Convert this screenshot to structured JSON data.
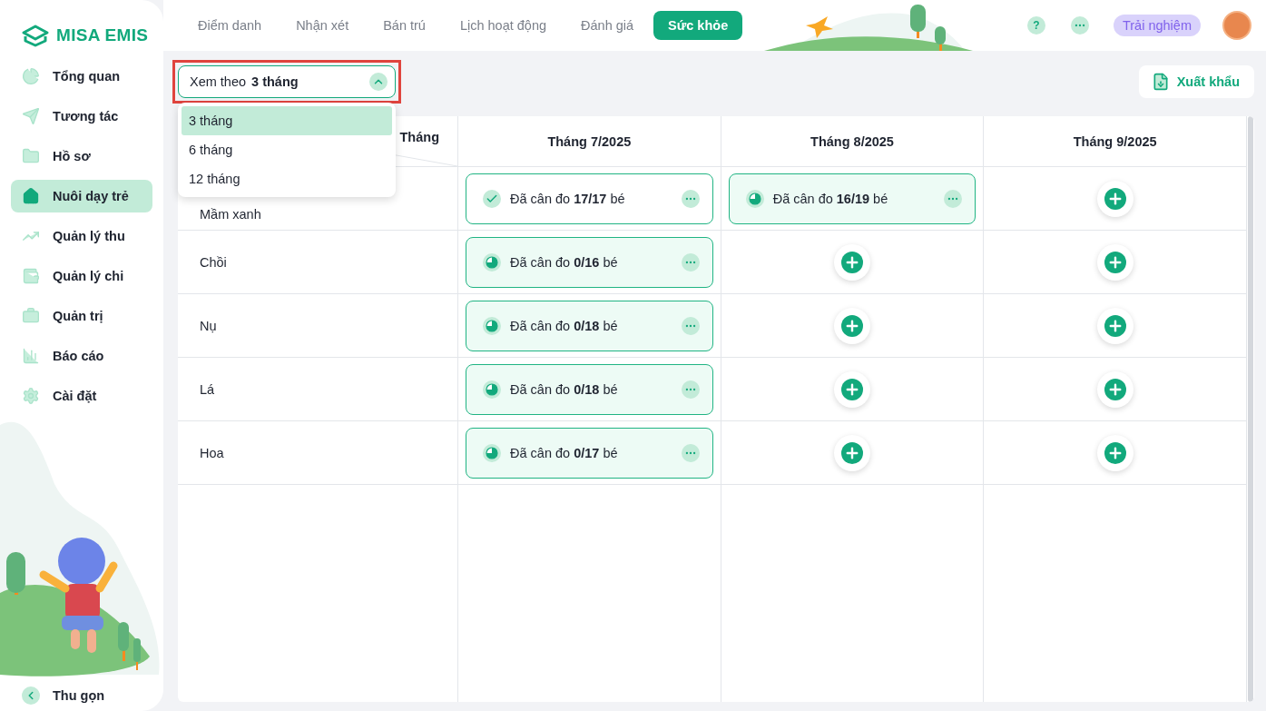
{
  "sidebar": {
    "logo": "MISA EMIS",
    "items": [
      {
        "label": "Tổng quan",
        "selected": false
      },
      {
        "label": "Tương tác",
        "selected": false
      },
      {
        "label": "Hồ sơ",
        "selected": false
      },
      {
        "label": "Nuôi dạy trẻ",
        "selected": true
      },
      {
        "label": "Quản lý thu",
        "selected": false
      },
      {
        "label": "Quản lý chi",
        "selected": false
      },
      {
        "label": "Quản trị",
        "selected": false
      },
      {
        "label": "Báo cáo",
        "selected": false
      },
      {
        "label": "Cài đặt",
        "selected": false
      }
    ],
    "collapse": "Thu gọn"
  },
  "tabs": [
    {
      "label": "Điểm danh",
      "selected": false
    },
    {
      "label": "Nhận xét",
      "selected": false
    },
    {
      "label": "Bán trú",
      "selected": false
    },
    {
      "label": "Lịch hoạt động",
      "selected": false
    },
    {
      "label": "Đánh giá",
      "selected": false
    },
    {
      "label": "Sức khỏe",
      "selected": true
    }
  ],
  "header": {
    "help": "?",
    "trial": "Trải nghiệm"
  },
  "toolbar": {
    "select": {
      "prefix": "Xem theo",
      "value": "3 tháng",
      "expanded": true,
      "options": [
        {
          "label": "3 tháng",
          "selected": true
        },
        {
          "label": "6 tháng",
          "selected": false
        },
        {
          "label": "12 tháng",
          "selected": false
        }
      ]
    },
    "export_button": "Xuất khẩu"
  },
  "table": {
    "corner_label": "Tháng",
    "columns": [
      "Tháng 7/2025",
      "Tháng 8/2025",
      "Tháng 9/2025"
    ],
    "rows": [
      {
        "label": "Mầm xanh",
        "cells": [
          {
            "kind": "status",
            "complete": true,
            "text": "Đã cân đo **17/17** bé"
          },
          {
            "kind": "status",
            "complete": false,
            "text": "Đã cân đo **16/19** bé"
          },
          {
            "kind": "add"
          }
        ]
      },
      {
        "label": "Chồi",
        "cells": [
          {
            "kind": "status",
            "complete": false,
            "text": "Đã cân đo **0/16** bé"
          },
          {
            "kind": "add"
          },
          {
            "kind": "add"
          }
        ]
      },
      {
        "label": "Nụ",
        "cells": [
          {
            "kind": "status",
            "complete": false,
            "text": "Đã cân đo **0/18** bé"
          },
          {
            "kind": "add"
          },
          {
            "kind": "add"
          }
        ]
      },
      {
        "label": "Lá",
        "cells": [
          {
            "kind": "status",
            "complete": false,
            "text": "Đã cân đo **0/18** bé"
          },
          {
            "kind": "add"
          },
          {
            "kind": "add"
          }
        ]
      },
      {
        "label": "Hoa",
        "cells": [
          {
            "kind": "status",
            "complete": false,
            "text": "Đã cân đo **0/17** bé"
          },
          {
            "kind": "add"
          },
          {
            "kind": "add"
          }
        ]
      }
    ]
  }
}
